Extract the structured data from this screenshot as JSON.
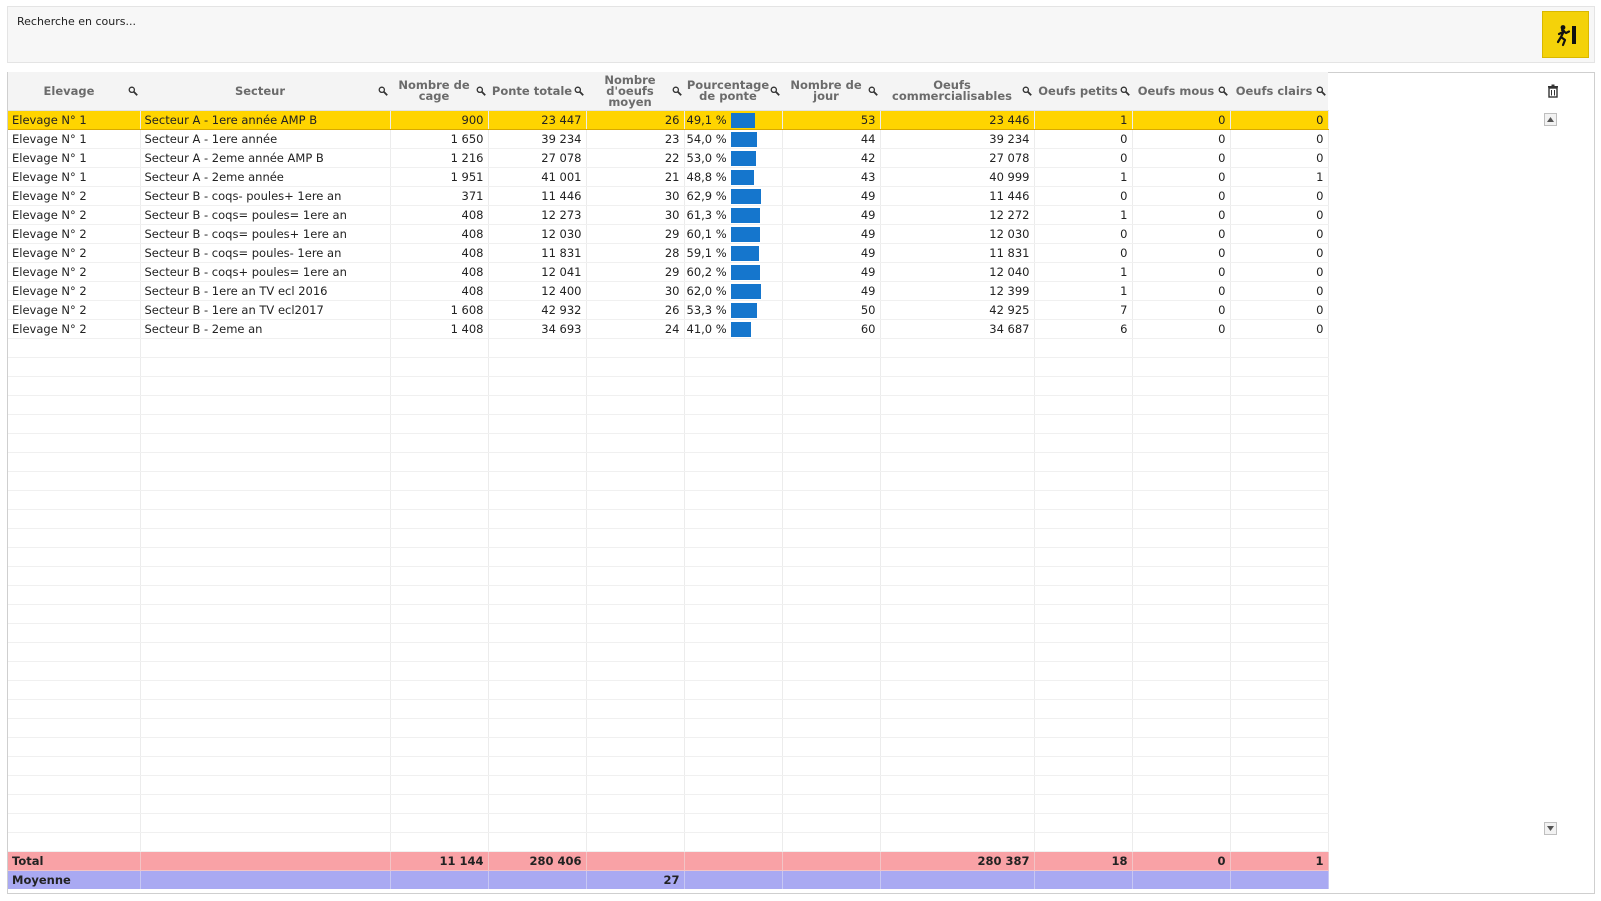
{
  "status": {
    "text": "Recherche en cours..."
  },
  "exit_button": {
    "icon": "exit-running-man-icon",
    "color": "#f4d20a"
  },
  "columns": [
    "Elevage",
    "Secteur",
    "Nombre de cage",
    "Ponte totale",
    "Nombre d'oeufs moyen",
    "Pourcentage de ponte",
    "Nombre de jour",
    "Oeufs commercialisables",
    "Oeufs petits",
    "Oeufs mous",
    "Oeufs clairs"
  ],
  "rows": [
    {
      "elevage": "Elevage N° 1",
      "secteur": "Secteur A - 1ere année AMP B",
      "cages": "900",
      "ponte": "23 447",
      "moyen": "26",
      "pct": "49,1 %",
      "pct_value": 49.1,
      "jours": "53",
      "comm": "23 446",
      "petits": "1",
      "mous": "0",
      "clairs": "0"
    },
    {
      "elevage": "Elevage N° 1",
      "secteur": "Secteur A - 1ere année",
      "cages": "1 650",
      "ponte": "39 234",
      "moyen": "23",
      "pct": "54,0 %",
      "pct_value": 54.0,
      "jours": "44",
      "comm": "39 234",
      "petits": "0",
      "mous": "0",
      "clairs": "0"
    },
    {
      "elevage": "Elevage N° 1",
      "secteur": "Secteur A - 2eme année AMP B",
      "cages": "1 216",
      "ponte": "27 078",
      "moyen": "22",
      "pct": "53,0 %",
      "pct_value": 53.0,
      "jours": "42",
      "comm": "27 078",
      "petits": "0",
      "mous": "0",
      "clairs": "0"
    },
    {
      "elevage": "Elevage N° 1",
      "secteur": "Secteur A - 2eme année",
      "cages": "1 951",
      "ponte": "41 001",
      "moyen": "21",
      "pct": "48,8 %",
      "pct_value": 48.8,
      "jours": "43",
      "comm": "40 999",
      "petits": "1",
      "mous": "0",
      "clairs": "1"
    },
    {
      "elevage": "Elevage N° 2",
      "secteur": "Secteur B - coqs- poules+ 1ere an",
      "cages": "371",
      "ponte": "11 446",
      "moyen": "30",
      "pct": "62,9 %",
      "pct_value": 62.9,
      "jours": "49",
      "comm": "11 446",
      "petits": "0",
      "mous": "0",
      "clairs": "0"
    },
    {
      "elevage": "Elevage N° 2",
      "secteur": "Secteur B - coqs= poules= 1ere an",
      "cages": "408",
      "ponte": "12 273",
      "moyen": "30",
      "pct": "61,3 %",
      "pct_value": 61.3,
      "jours": "49",
      "comm": "12 272",
      "petits": "1",
      "mous": "0",
      "clairs": "0"
    },
    {
      "elevage": "Elevage N° 2",
      "secteur": "Secteur B - coqs= poules+ 1ere an",
      "cages": "408",
      "ponte": "12 030",
      "moyen": "29",
      "pct": "60,1 %",
      "pct_value": 60.1,
      "jours": "49",
      "comm": "12 030",
      "petits": "0",
      "mous": "0",
      "clairs": "0"
    },
    {
      "elevage": "Elevage N° 2",
      "secteur": "Secteur B - coqs= poules- 1ere an",
      "cages": "408",
      "ponte": "11 831",
      "moyen": "28",
      "pct": "59,1 %",
      "pct_value": 59.1,
      "jours": "49",
      "comm": "11 831",
      "petits": "0",
      "mous": "0",
      "clairs": "0"
    },
    {
      "elevage": "Elevage N° 2",
      "secteur": "Secteur B - coqs+ poules= 1ere an",
      "cages": "408",
      "ponte": "12 041",
      "moyen": "29",
      "pct": "60,2 %",
      "pct_value": 60.2,
      "jours": "49",
      "comm": "12 040",
      "petits": "1",
      "mous": "0",
      "clairs": "0"
    },
    {
      "elevage": "Elevage N° 2",
      "secteur": "Secteur B - 1ere an TV ecl 2016",
      "cages": "408",
      "ponte": "12 400",
      "moyen": "30",
      "pct": "62,0 %",
      "pct_value": 62.0,
      "jours": "49",
      "comm": "12 399",
      "petits": "1",
      "mous": "0",
      "clairs": "0"
    },
    {
      "elevage": "Elevage N° 2",
      "secteur": "Secteur B - 1ere an TV ecl2017",
      "cages": "1 608",
      "ponte": "42 932",
      "moyen": "26",
      "pct": "53,3 %",
      "pct_value": 53.3,
      "jours": "50",
      "comm": "42 925",
      "petits": "7",
      "mous": "0",
      "clairs": "0"
    },
    {
      "elevage": "Elevage N° 2",
      "secteur": "Secteur B - 2eme an",
      "cages": "1 408",
      "ponte": "34 693",
      "moyen": "24",
      "pct": "41,0 %",
      "pct_value": 41.0,
      "jours": "60",
      "comm": "34 687",
      "petits": "6",
      "mous": "0",
      "clairs": "0"
    }
  ],
  "totals": {
    "label": "Total",
    "cages": "11 144",
    "ponte": "280 406",
    "comm": "280 387",
    "petits": "18",
    "mous": "0",
    "clairs": "1"
  },
  "average": {
    "label": "Moyenne",
    "moyen": "27"
  },
  "colors": {
    "selected_row": "#ffd400",
    "bar": "#1576cd",
    "total_row": "#f9a2a6",
    "average_row": "#a9a9f2"
  }
}
